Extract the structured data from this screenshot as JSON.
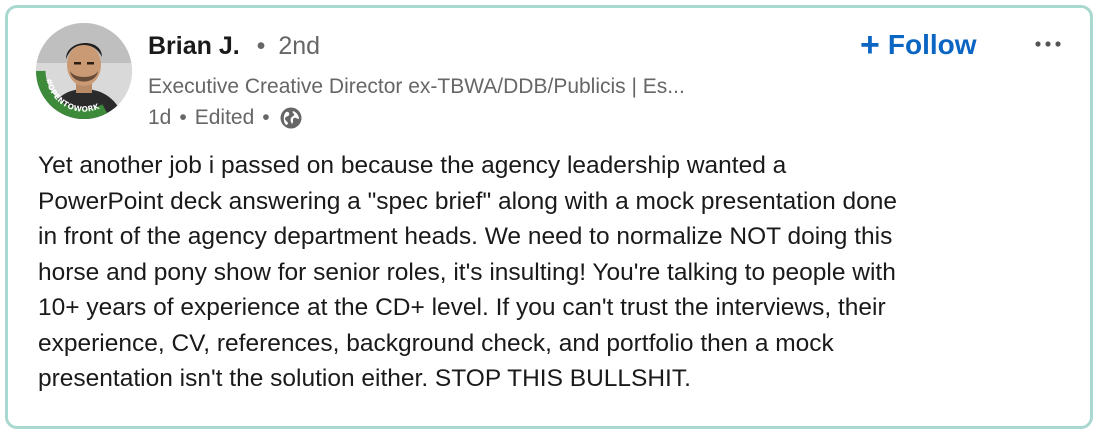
{
  "post": {
    "author": {
      "name": "Brian J.",
      "separator": "•",
      "degree": "2nd",
      "headline": "Executive Creative Director ex-TBWA/DDB/Publicis | Es...",
      "avatar_badge": "#OPENTOWORK"
    },
    "meta": {
      "age": "1d",
      "sep1": "•",
      "edited": "Edited",
      "sep2": "•",
      "visibility_icon": "globe-icon"
    },
    "actions": {
      "follow_plus": "+",
      "follow_label": "Follow",
      "more_icon": "more-options-icon"
    },
    "body": "Yet another job i passed on because the agency leadership wanted a\nPowerPoint deck answering a \"spec brief\" along with a mock presentation done\nin front of the agency department heads. We need to normalize NOT doing this\nhorse and pony show for senior roles, it's insulting! You're talking to people with\n10+ years of experience at the CD+ level. If you can't trust the interviews, their\nexperience, CV, references, background check, and portfolio then a mock\npresentation isn't the solution either. STOP THIS BULLSHIT."
  },
  "colors": {
    "card_border": "#a8d8cf",
    "follow_blue": "#0a66c2",
    "open_to_work_green": "#3c8a3a",
    "secondary_text": "#666666",
    "primary_text": "#1a1a1a"
  }
}
